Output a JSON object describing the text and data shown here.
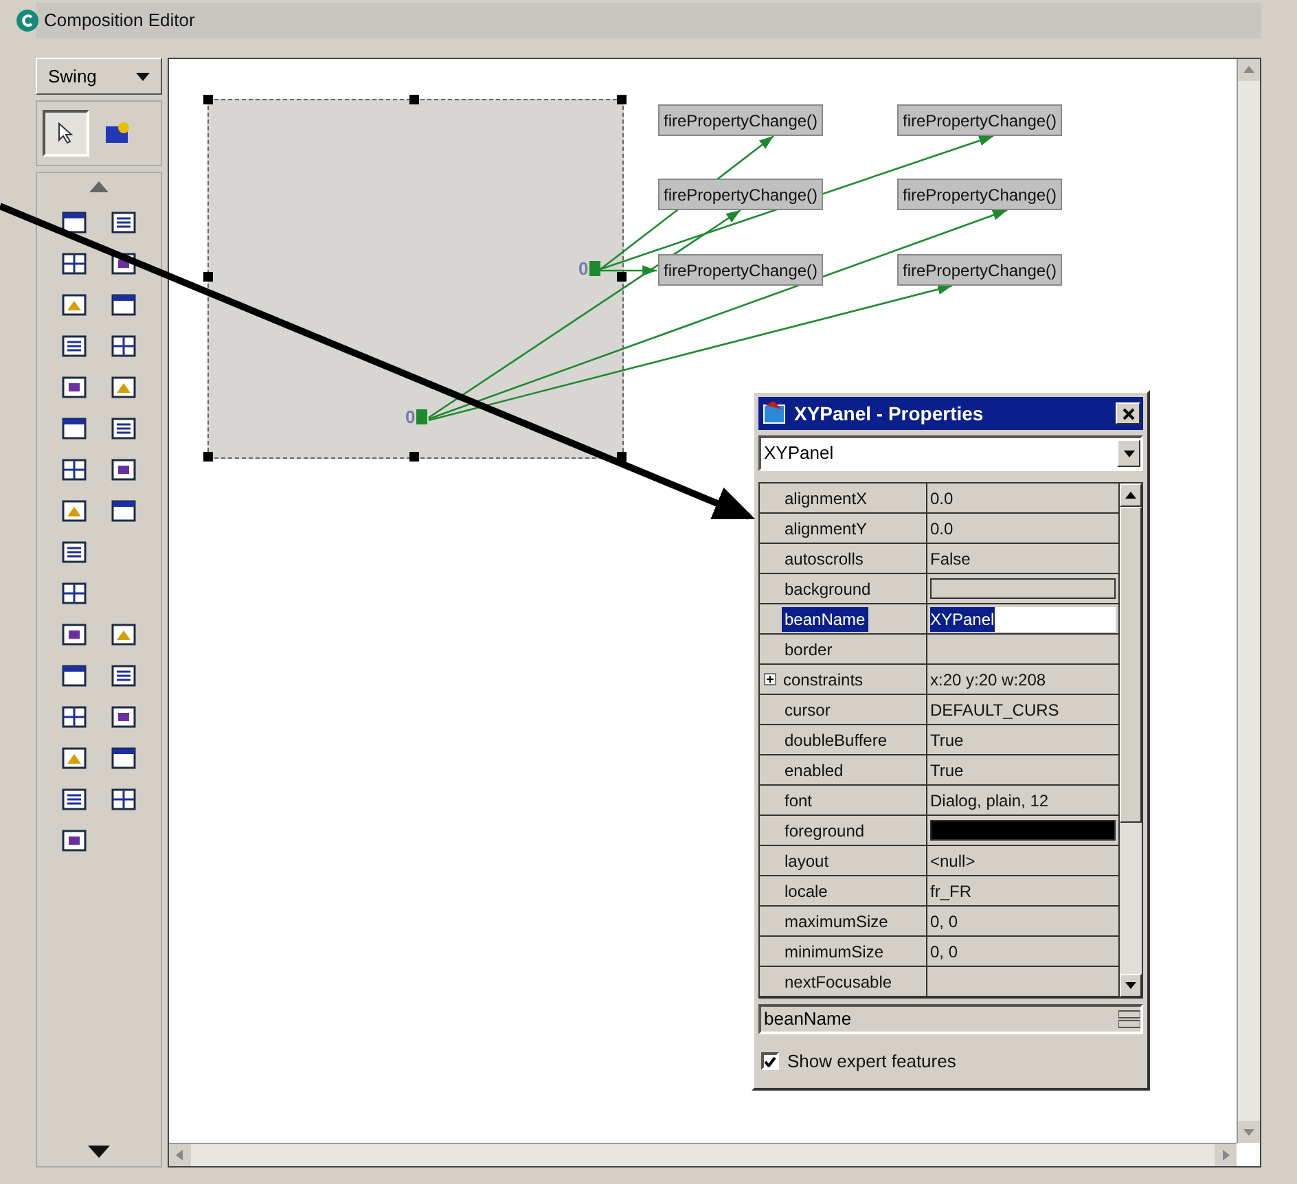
{
  "window": {
    "title": "Composition Editor"
  },
  "palette": {
    "category": "Swing",
    "selection_tools": [
      {
        "selected": true
      },
      {
        "selected": false
      }
    ]
  },
  "canvas": {
    "anchors": [
      {
        "label": "0"
      },
      {
        "label": "0"
      }
    ],
    "method_nodes": [
      {
        "label": "firePropertyChange()"
      },
      {
        "label": "firePropertyChange()"
      },
      {
        "label": "firePropertyChange()"
      },
      {
        "label": "firePropertyChange()"
      },
      {
        "label": "firePropertyChange()"
      },
      {
        "label": "firePropertyChange()"
      }
    ]
  },
  "properties_window": {
    "title": "XYPanel - Properties",
    "bean_selector": "XYPanel",
    "properties": [
      {
        "name": "alignmentX",
        "kind": "text",
        "value": "0.0",
        "selected": false
      },
      {
        "name": "alignmentY",
        "kind": "text",
        "value": "0.0",
        "selected": false
      },
      {
        "name": "autoscrolls",
        "kind": "text",
        "value": "False",
        "selected": false
      },
      {
        "name": "background",
        "kind": "swatch",
        "color": "#d4d0c8",
        "selected": false
      },
      {
        "name": "beanName",
        "kind": "text",
        "value": "XYPanel",
        "selected": true
      },
      {
        "name": "border",
        "kind": "empty",
        "selected": false
      },
      {
        "name": "constraints",
        "kind": "expandable",
        "value": "x:20 y:20 w:208",
        "selected": false
      },
      {
        "name": "cursor",
        "kind": "text",
        "value": "DEFAULT_CURS",
        "selected": false
      },
      {
        "name": "doubleBuffere",
        "kind": "text",
        "value": "True",
        "selected": false
      },
      {
        "name": "enabled",
        "kind": "text",
        "value": "True",
        "selected": false
      },
      {
        "name": "font",
        "kind": "text",
        "value": "Dialog, plain, 12",
        "selected": false
      },
      {
        "name": "foreground",
        "kind": "swatch",
        "color": "#000000",
        "selected": false
      },
      {
        "name": "layout",
        "kind": "text",
        "value": "<null>",
        "selected": false
      },
      {
        "name": "locale",
        "kind": "text",
        "value": "fr_FR",
        "selected": false
      },
      {
        "name": "maximumSize",
        "kind": "text",
        "value": "0, 0",
        "selected": false
      },
      {
        "name": "minimumSize",
        "kind": "text",
        "value": "0, 0",
        "selected": false
      },
      {
        "name": "nextFocusable",
        "kind": "empty",
        "selected": false
      }
    ],
    "selected_property": "beanName",
    "show_expert_features": {
      "label": "Show expert features",
      "checked": true
    }
  }
}
